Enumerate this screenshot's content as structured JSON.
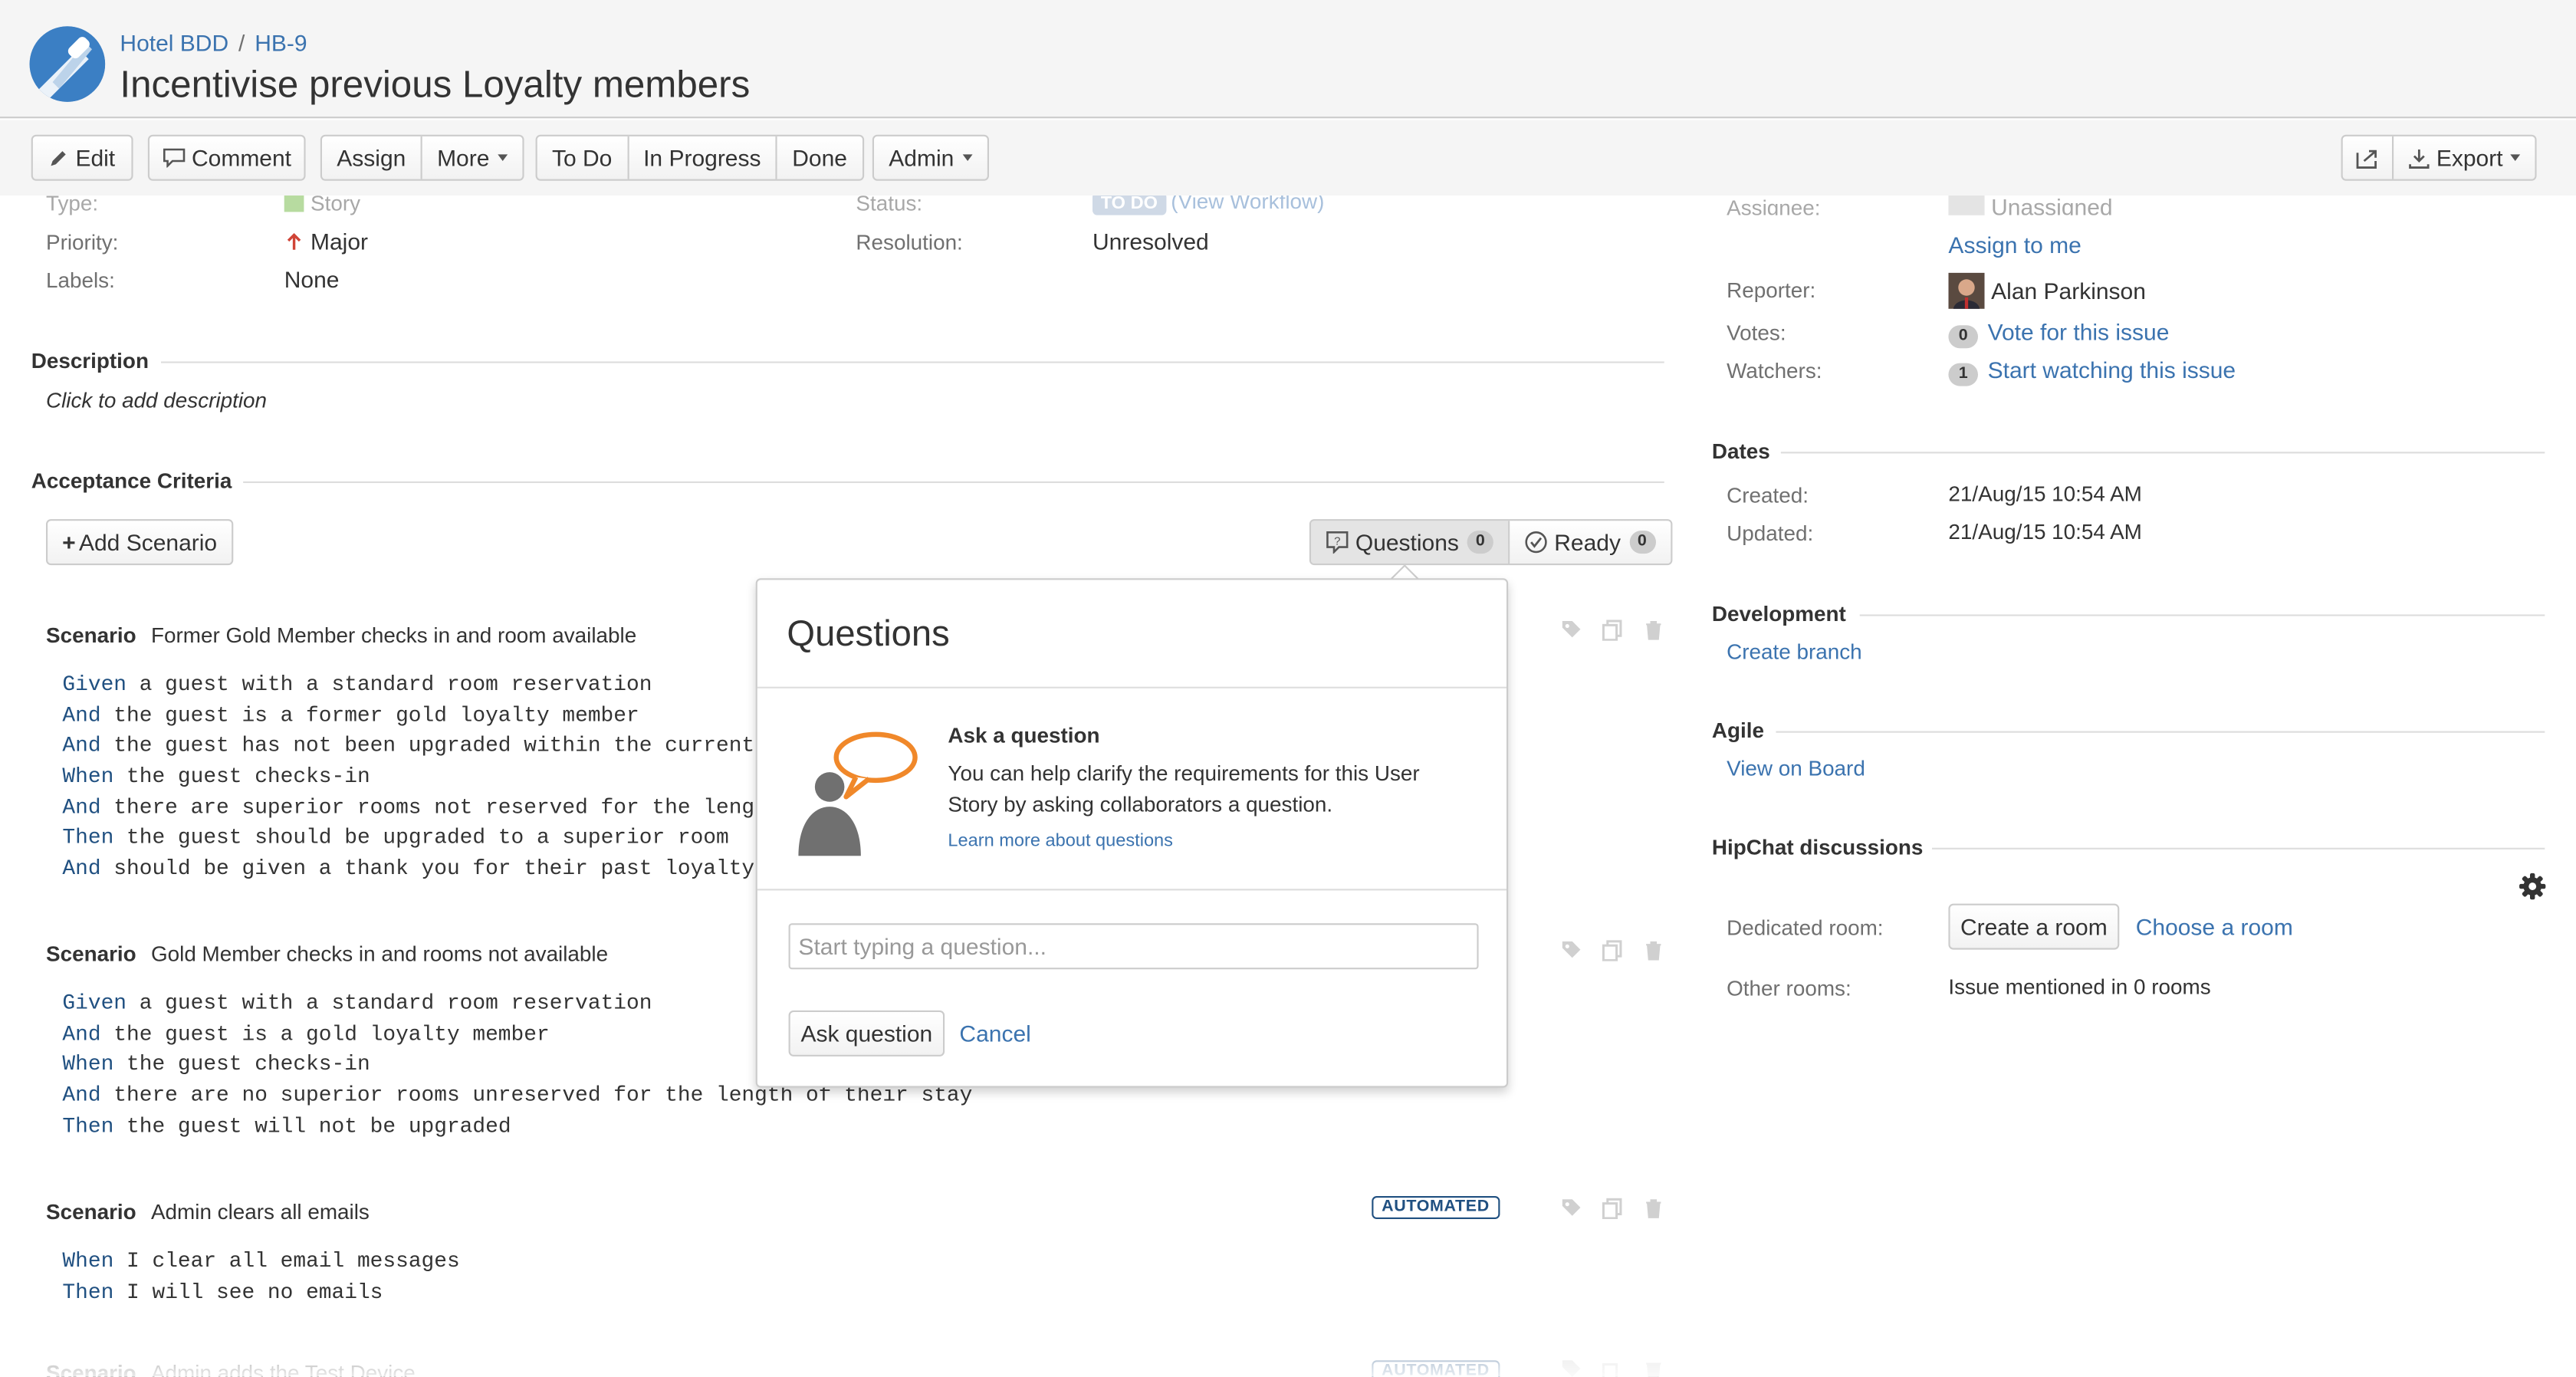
{
  "breadcrumb": {
    "project": "Hotel BDD",
    "separator": "/",
    "issue_key": "HB-9"
  },
  "issue": {
    "title": "Incentivise previous Loyalty members"
  },
  "toolbar": {
    "edit": "Edit",
    "comment": "Comment",
    "assign": "Assign",
    "more": "More",
    "todo": "To Do",
    "in_progress": "In Progress",
    "done": "Done",
    "admin": "Admin",
    "export": "Export"
  },
  "details": {
    "type_label": "Type:",
    "type_value": "Story",
    "status_label": "Status:",
    "status_value": "TO DO",
    "view_workflow": "(View Workflow)",
    "priority_label": "Priority:",
    "priority_value": "Major",
    "resolution_label": "Resolution:",
    "resolution_value": "Unresolved",
    "labels_label": "Labels:",
    "labels_value": "None"
  },
  "description": {
    "heading": "Description",
    "placeholder": "Click to add description"
  },
  "acceptance": {
    "heading": "Acceptance Criteria",
    "add_scenario": "Add Scenario",
    "questions_label": "Questions",
    "questions_count": "0",
    "ready_label": "Ready",
    "ready_count": "0",
    "scenario_keyword": "Scenario",
    "automated_badge": "AUTOMATED",
    "scenarios": [
      {
        "title": "Former Gold Member checks in and room available",
        "steps": [
          {
            "kw": "Given",
            "text": " a guest with a standard room reservation"
          },
          {
            "kw": "And",
            "text": " the guest is a former gold loyalty member"
          },
          {
            "kw": "And",
            "text": " the guest has not been upgraded within the current"
          },
          {
            "kw": "When",
            "text": " the guest checks-in"
          },
          {
            "kw": "And",
            "text": " there are superior rooms not reserved for the leng"
          },
          {
            "kw": "Then",
            "text": " the guest should be upgraded to a superior room"
          },
          {
            "kw": "And",
            "text": " should be given a thank you for their past loyalty"
          }
        ]
      },
      {
        "title": "Gold Member checks in and rooms not available",
        "steps": [
          {
            "kw": "Given",
            "text": " a guest with a standard room reservation"
          },
          {
            "kw": "And",
            "text": " the guest is a gold loyalty member"
          },
          {
            "kw": "When",
            "text": " the guest checks-in"
          },
          {
            "kw": "And",
            "text": " there are no superior rooms unreserved for the length of their stay"
          },
          {
            "kw": "Then",
            "text": " the guest will not be upgraded"
          }
        ]
      },
      {
        "title": "Admin clears all emails",
        "steps": [
          {
            "kw": "When",
            "text": " I clear all email messages"
          },
          {
            "kw": "Then",
            "text": " I will see no emails"
          }
        ]
      },
      {
        "title": "Admin adds the Test Device"
      }
    ]
  },
  "questions_popup": {
    "title": "Questions",
    "ask_heading": "Ask a question",
    "ask_body": "You can help clarify the requirements for this User Story by asking collaborators a question.",
    "learn_more": "Learn more about questions",
    "input_placeholder": "Start typing a question...",
    "ask_button": "Ask question",
    "cancel": "Cancel"
  },
  "people": {
    "assignee_label": "Assignee:",
    "assignee_value": "Unassigned",
    "assign_to_me": "Assign to me",
    "reporter_label": "Reporter:",
    "reporter_value": "Alan Parkinson",
    "votes_label": "Votes:",
    "votes_count": "0",
    "vote_link": "Vote for this issue",
    "watchers_label": "Watchers:",
    "watchers_count": "1",
    "watch_link": "Start watching this issue"
  },
  "dates": {
    "heading": "Dates",
    "created_label": "Created:",
    "created_value": "21/Aug/15 10:54 AM",
    "updated_label": "Updated:",
    "updated_value": "21/Aug/15 10:54 AM"
  },
  "development": {
    "heading": "Development",
    "create_branch": "Create branch"
  },
  "agile": {
    "heading": "Agile",
    "view_on_board": "View on Board"
  },
  "hipchat": {
    "heading": "HipChat discussions",
    "dedicated_label": "Dedicated room:",
    "create_room": "Create a room",
    "choose_room": "Choose a room",
    "other_label": "Other rooms:",
    "other_value": "Issue mentioned in 0 rooms"
  },
  "colors": {
    "link": "#3b73af",
    "keyword": "#205081",
    "logo": "#3b7fc4",
    "speech_bubble": "#f0882a"
  }
}
